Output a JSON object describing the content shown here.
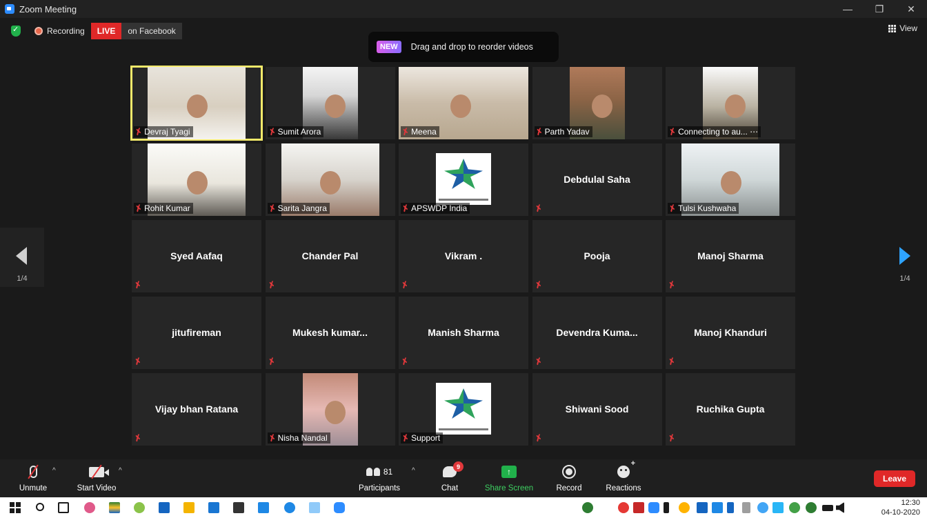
{
  "window": {
    "title": "Zoom Meeting",
    "controls": [
      "—",
      "❐",
      "✕"
    ]
  },
  "status_bar": {
    "recording_label": "Recording",
    "live_label": "LIVE",
    "live_destination": "on Facebook",
    "view_label": "View"
  },
  "tip": {
    "badge": "NEW",
    "text": "Drag and drop to reorder videos"
  },
  "pager": {
    "left_page": "1/4",
    "right_page": "1/4"
  },
  "participants": [
    {
      "name": "Devraj Tyagi",
      "video": "office",
      "active": true
    },
    {
      "name": "Sumit Arora",
      "video": "bw"
    },
    {
      "name": "Meena",
      "video": "room"
    },
    {
      "name": "Parth Yadav",
      "video": "curtain"
    },
    {
      "name": "Connecting to au... ⋯",
      "video": "dim"
    },
    {
      "name": "Rohit Kumar",
      "video": "car"
    },
    {
      "name": "Sarita Jangra",
      "video": "shop"
    },
    {
      "name": "APSWDP India",
      "video": "logo"
    },
    {
      "name": "Debdulal Saha"
    },
    {
      "name": "Tulsi Kushwaha",
      "video": "plain"
    },
    {
      "name": "Syed Aafaq"
    },
    {
      "name": "Chander Pal"
    },
    {
      "name": "Vikram ."
    },
    {
      "name": "Pooja"
    },
    {
      "name": "Manoj Sharma"
    },
    {
      "name": "jitufireman"
    },
    {
      "name": "Mukesh  kumar..."
    },
    {
      "name": "Manish Sharma"
    },
    {
      "name": "Devendra  Kuma..."
    },
    {
      "name": "Manoj Khanduri"
    },
    {
      "name": "Vijay bhan Ratana"
    },
    {
      "name": "Nisha Nandal",
      "video": "baby"
    },
    {
      "name": "Support",
      "video": "logo"
    },
    {
      "name": "Shiwani Sood"
    },
    {
      "name": "Ruchika Gupta"
    }
  ],
  "toolbar": {
    "unmute": "Unmute",
    "start_video": "Start Video",
    "participants": "Participants",
    "participants_count": "81",
    "chat": "Chat",
    "chat_badge": "9",
    "share_screen": "Share Screen",
    "record": "Record",
    "reactions": "Reactions",
    "leave": "Leave"
  },
  "taskbar": {
    "time": "12:30",
    "date": "04-10-2020"
  },
  "colors": {
    "accent": "#2d8cff",
    "live": "#e02828",
    "share": "#21b14b",
    "active_speaker": "#f3e96a"
  }
}
